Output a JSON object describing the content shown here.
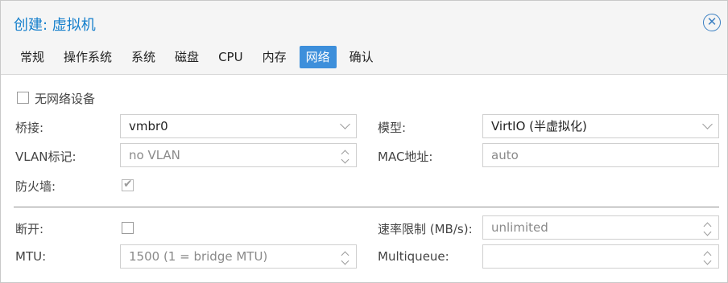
{
  "window": {
    "title": "创建: 虚拟机"
  },
  "tabs": [
    {
      "label": "常规"
    },
    {
      "label": "操作系统"
    },
    {
      "label": "系统"
    },
    {
      "label": "磁盘"
    },
    {
      "label": "CPU"
    },
    {
      "label": "内存"
    },
    {
      "label": "网络",
      "active": true
    },
    {
      "label": "确认"
    }
  ],
  "network": {
    "no_device_label": "无网络设备",
    "bridge_label": "桥接:",
    "bridge_value": "vmbr0",
    "model_label": "模型:",
    "model_value": "VirtIO (半虚拟化)",
    "vlan_label": "VLAN标记:",
    "vlan_placeholder": "no VLAN",
    "mac_label": "MAC地址:",
    "mac_value": "auto",
    "firewall_label": "防火墙:",
    "disconnect_label": "断开:",
    "rate_label": "速率限制 (MB/s):",
    "rate_placeholder": "unlimited",
    "mtu_label": "MTU:",
    "mtu_placeholder": "1500 (1 = bridge MTU)",
    "multiqueue_label": "Multiqueue:",
    "multiqueue_value": ""
  },
  "colors": {
    "accent": "#3d8fdb",
    "title": "#157fcc"
  },
  "icons": {
    "close": "close-circle-icon",
    "dropdown": "chevron-down-icon",
    "spinner": "spinner-icon",
    "check": "checkmark-icon"
  }
}
